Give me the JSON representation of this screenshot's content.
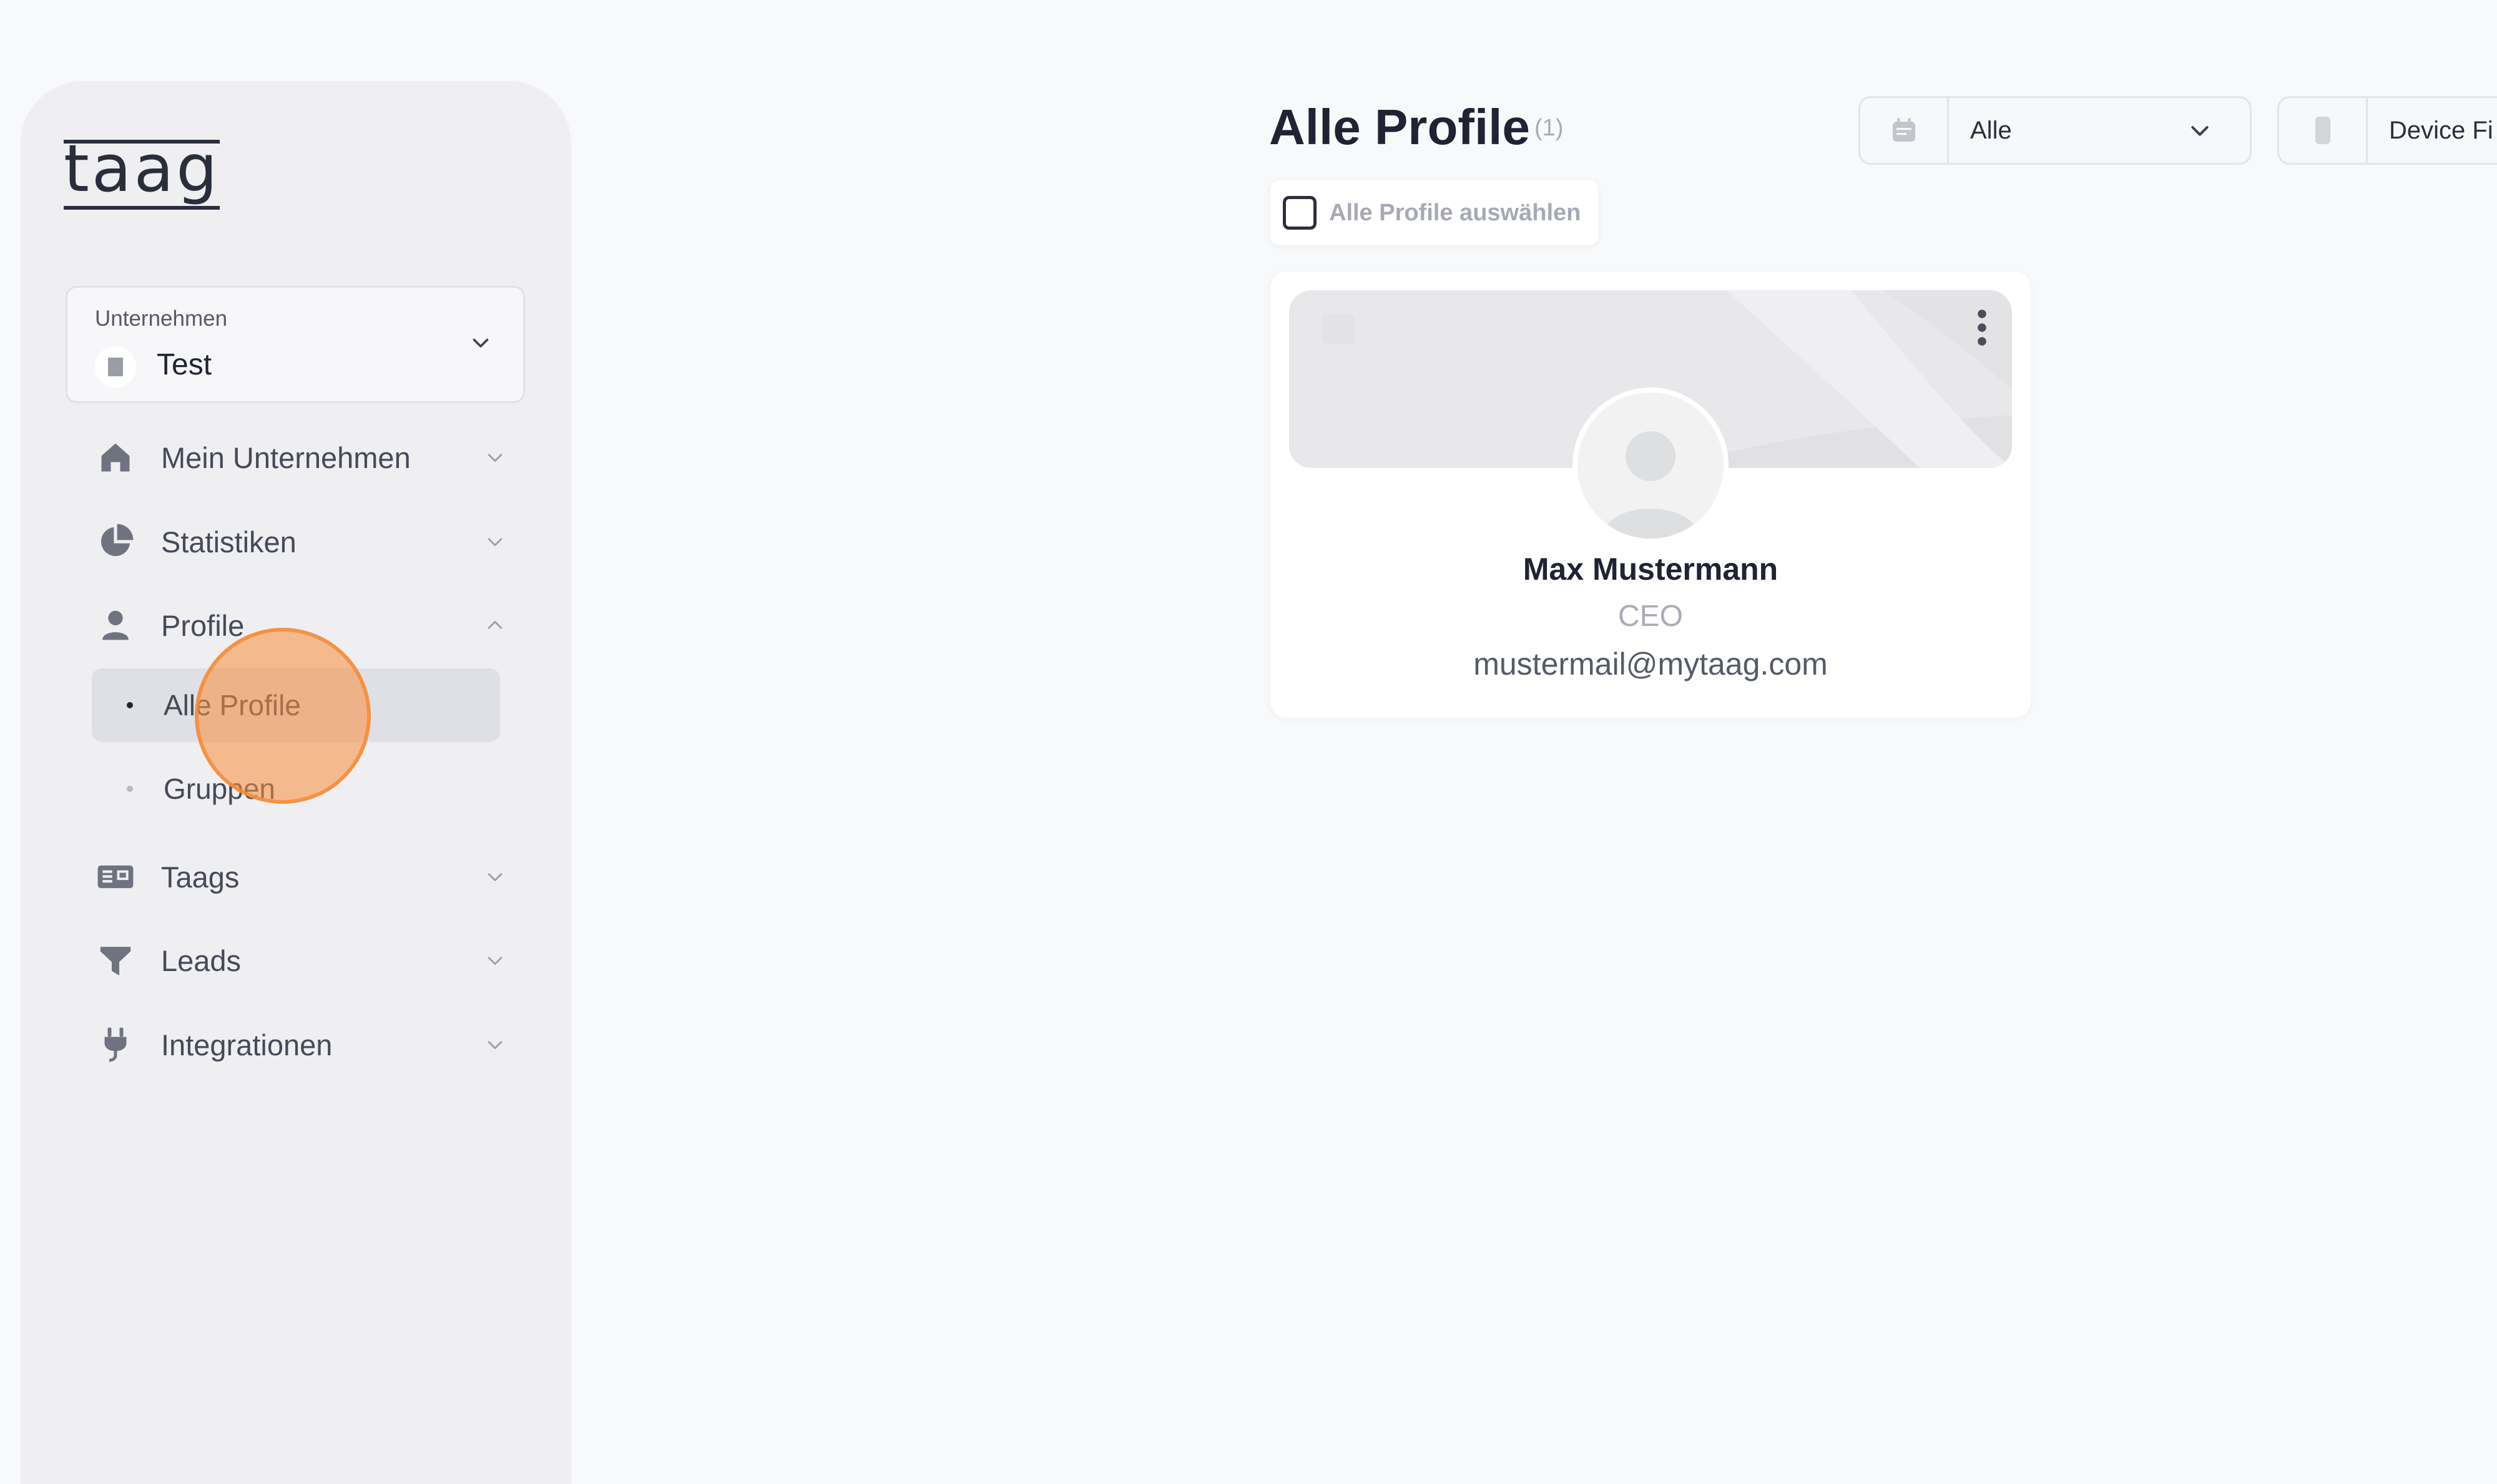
{
  "brand": {
    "logo_text": "taag"
  },
  "company_selector": {
    "label": "Unternehmen",
    "value": "Test"
  },
  "sidebar": {
    "items": [
      {
        "label": "Mein Unternehmen",
        "icon": "home-icon",
        "expanded": false
      },
      {
        "label": "Statistiken",
        "icon": "pie-chart-icon",
        "expanded": false
      },
      {
        "label": "Profile",
        "icon": "user-icon",
        "expanded": true,
        "children": [
          {
            "label": "Alle Profile",
            "active": true
          },
          {
            "label": "Gruppen",
            "active": false
          }
        ]
      },
      {
        "label": "Taags",
        "icon": "card-icon",
        "expanded": false
      },
      {
        "label": "Leads",
        "icon": "filter-icon",
        "expanded": false
      },
      {
        "label": "Integrationen",
        "icon": "plug-icon",
        "expanded": false
      }
    ]
  },
  "main": {
    "title": "Alle Profile",
    "count": "(1)",
    "select_all_label": "Alle Profile auswählen",
    "filters": [
      {
        "value": "Alle",
        "icon": "calendar-icon"
      },
      {
        "value": "Device Fi",
        "icon": "device-icon"
      }
    ]
  },
  "profiles": [
    {
      "name": "Max Mustermann",
      "role": "CEO",
      "email": "mustermail@mytaag.com"
    }
  ],
  "colors": {
    "background": "#f8f9fb",
    "sidebar": "#efeff2",
    "active_item": "#dfe0e6",
    "click_highlight": "#f58c37"
  }
}
